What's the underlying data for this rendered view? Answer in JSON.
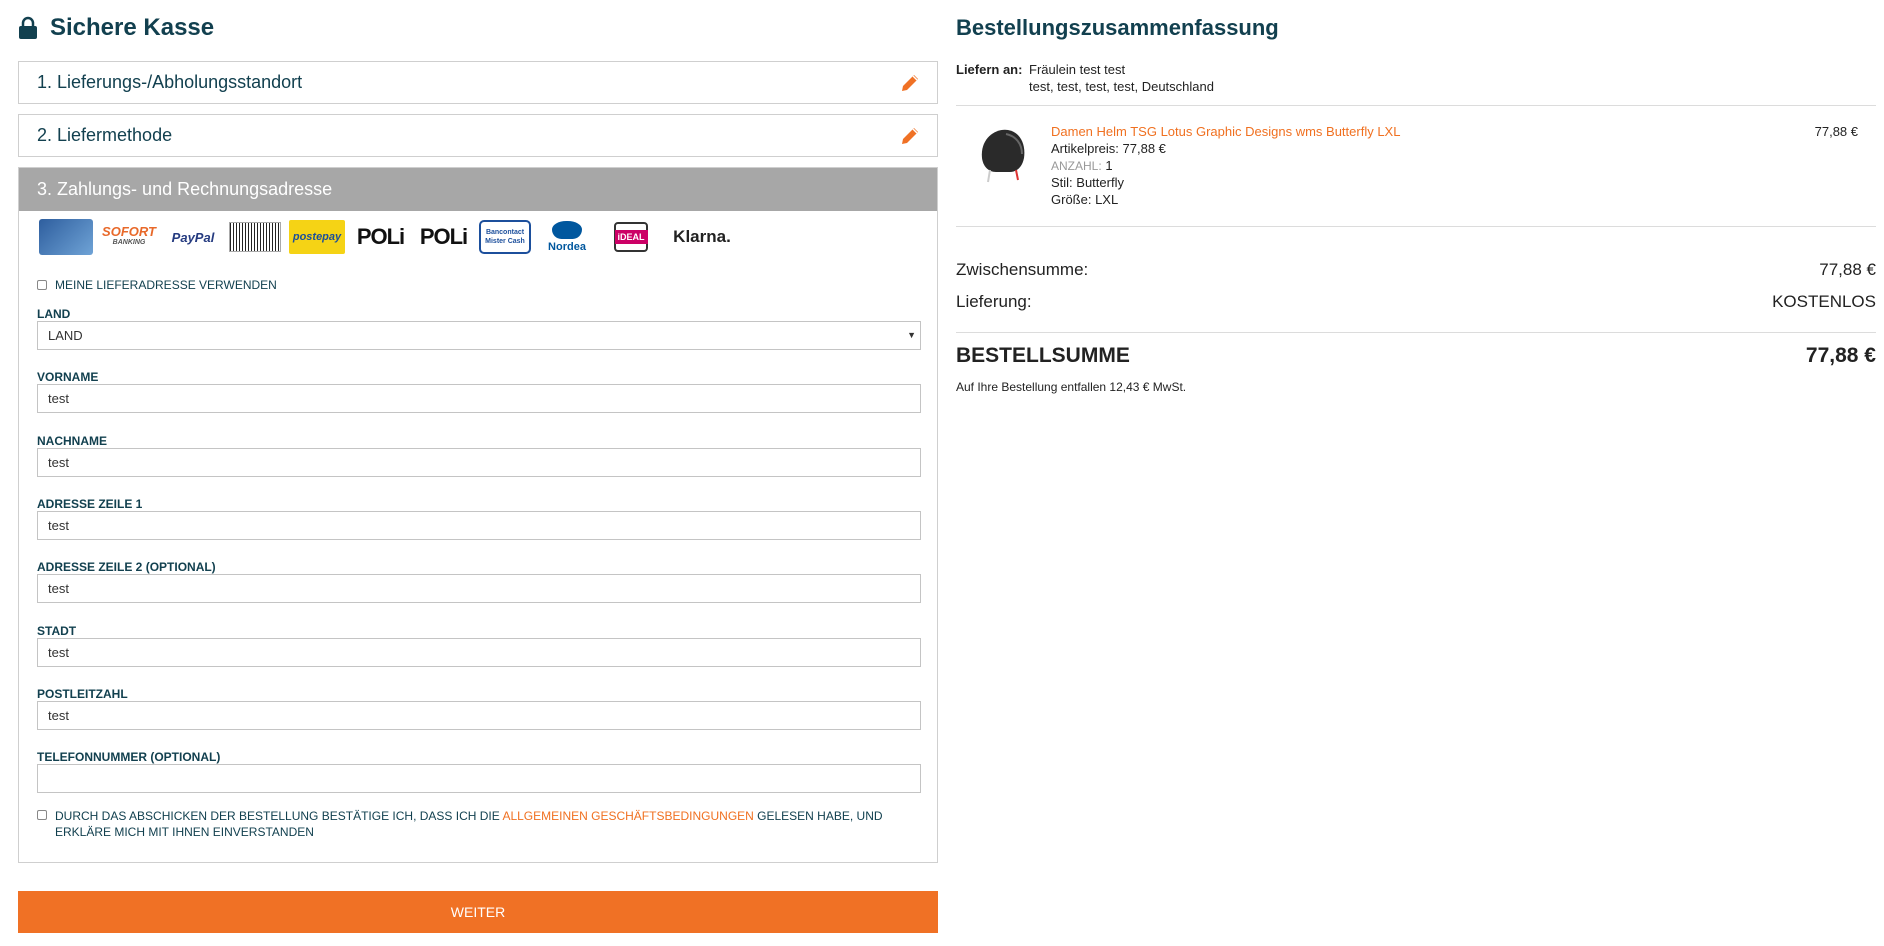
{
  "header": {
    "title": "Sichere Kasse"
  },
  "steps": {
    "step1": "1. Lieferungs-/Abholungsstandort",
    "step2": "2. Liefermethode",
    "step3": "3. Zahlungs- und Rechnungsadresse"
  },
  "payment_logos": [
    "SOFORT",
    "BANKING",
    "PayPal",
    "postepay",
    "POLi",
    "POLi",
    "Bancontact",
    "Mister Cash",
    "Nordea",
    "iDEAL",
    "Klarna."
  ],
  "form": {
    "use_delivery_address": "MEINE LIEFERADRESSE VERWENDEN",
    "country_label": "LAND",
    "country_value": "LAND",
    "firstname_label": "VORNAME",
    "firstname_value": "test",
    "lastname_label": "NACHNAME",
    "lastname_value": "test",
    "address1_label": "ADRESSE ZEILE 1",
    "address1_value": "test",
    "address2_label": "ADRESSE ZEILE 2 (OPTIONAL)",
    "address2_value": "test",
    "city_label": "STADT",
    "city_value": "test",
    "zip_label": "POSTLEITZAHL",
    "zip_value": "test",
    "phone_label": "TELEFONNUMMER (OPTIONAL)",
    "phone_value": "",
    "terms_prefix": "DURCH DAS ABSCHICKEN DER BESTELLUNG BESTÄTIGE ICH, DASS ICH DIE ",
    "terms_link": "ALLGEMEINEN GESCHÄFTSBEDINGUNGEN",
    "terms_suffix": " GELESEN HABE, UND ERKLÄRE MICH MIT IHNEN EINVERSTANDEN"
  },
  "submit_label": "WEITER",
  "summary": {
    "title": "Bestellungszusammenfassung",
    "ship_label": "Liefern an:",
    "ship_name": "Fräulein test test",
    "ship_address": "test,  test,  test,  test,  Deutschland",
    "product": {
      "name": "Damen Helm TSG Lotus Graphic Designs wms Butterfly LXL",
      "price_right": "77,88 €",
      "unit_price": "Artikelpreis:  77,88 €",
      "qty_label": "ANZAHL:",
      "qty_value": "1",
      "style": "Stil: Butterfly",
      "size": "Größe: LXL"
    },
    "subtotal_label": "Zwischensumme:",
    "subtotal_value": "77,88 €",
    "shipping_label": "Lieferung:",
    "shipping_value": "KOSTENLOS",
    "total_label": "BESTELLSUMME",
    "total_value": "77,88 €",
    "tax_note": "Auf Ihre Bestellung entfallen 12,43 € MwSt."
  },
  "colors": {
    "accent": "#f07125",
    "heading": "#12404f",
    "step_active_bg": "#a7a7a7"
  }
}
